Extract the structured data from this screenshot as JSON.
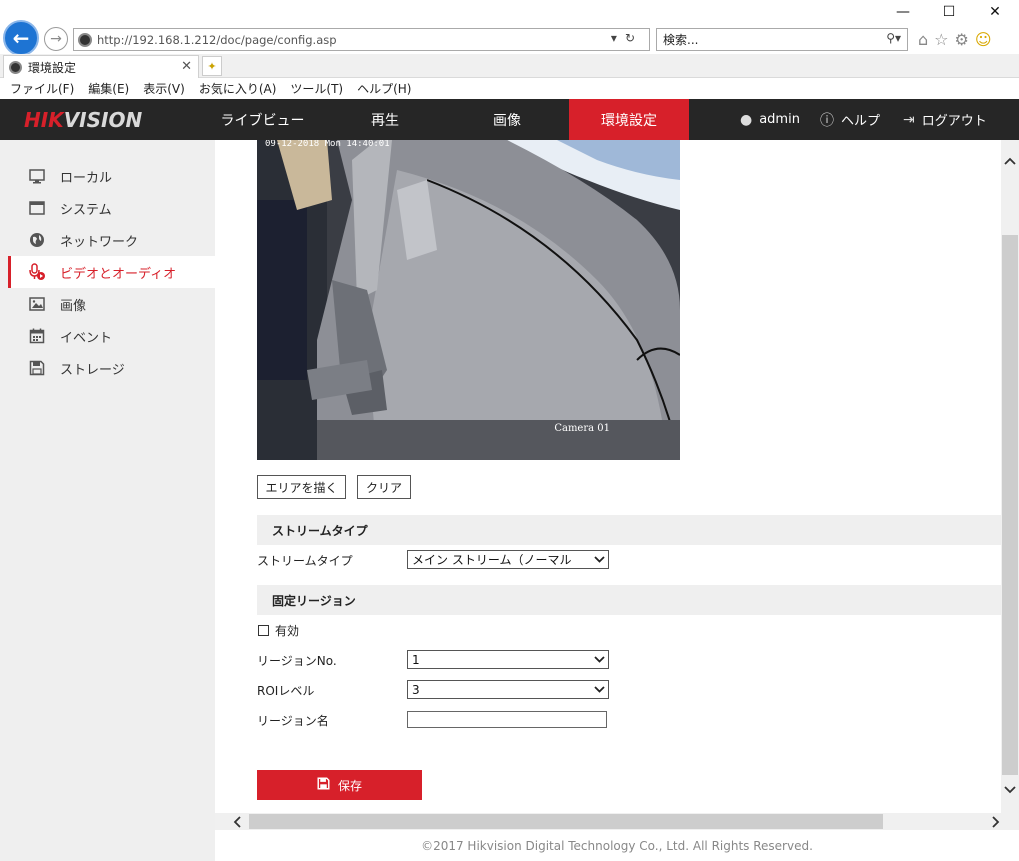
{
  "browser": {
    "address": "http://192.168.1.212/doc/page/config.asp",
    "search_placeholder": "検索...",
    "tab_title": "環境設定",
    "menu": [
      "ファイル(F)",
      "編集(E)",
      "表示(V)",
      "お気に入り(A)",
      "ツール(T)",
      "ヘルプ(H)"
    ]
  },
  "header": {
    "logo_hik": "HIK",
    "logo_vision": "VISION",
    "nav": [
      "ライブビュー",
      "再生",
      "画像",
      "環境設定"
    ],
    "active_nav": "環境設定",
    "user": "admin",
    "help": "ヘルプ",
    "logout": "ログアウト"
  },
  "sidebar": {
    "items": [
      {
        "label": "ローカル",
        "icon": "monitor-icon"
      },
      {
        "label": "システム",
        "icon": "window-icon"
      },
      {
        "label": "ネットワーク",
        "icon": "globe-icon"
      },
      {
        "label": "ビデオとオーディオ",
        "icon": "microphone-icon"
      },
      {
        "label": "画像",
        "icon": "image-icon"
      },
      {
        "label": "イベント",
        "icon": "calendar-icon"
      },
      {
        "label": "ストレージ",
        "icon": "save-icon"
      }
    ],
    "active_index": 3
  },
  "video": {
    "timestamp": "09-12-2018 Mon 14:40:01",
    "camera_label": "Camera 01"
  },
  "buttons": {
    "draw_area": "エリアを描く",
    "clear": "クリア",
    "save": "保存"
  },
  "stream_section": {
    "title": "ストリームタイプ",
    "label": "ストリームタイプ",
    "value": "メイン ストリーム（ノーマル"
  },
  "region_section": {
    "title": "固定リージョン",
    "enable_label": "有効",
    "enable_checked": false,
    "region_no_label": "リージョンNo.",
    "region_no_value": "1",
    "roi_level_label": "ROIレベル",
    "roi_level_value": "3",
    "region_name_label": "リージョン名",
    "region_name_value": ""
  },
  "footer": {
    "copyright": "©2017 Hikvision Digital Technology Co., Ltd. All Rights Reserved."
  },
  "colors": {
    "accent": "#d7202a",
    "header_bg": "#262626",
    "sidebar_bg": "#efefef"
  }
}
